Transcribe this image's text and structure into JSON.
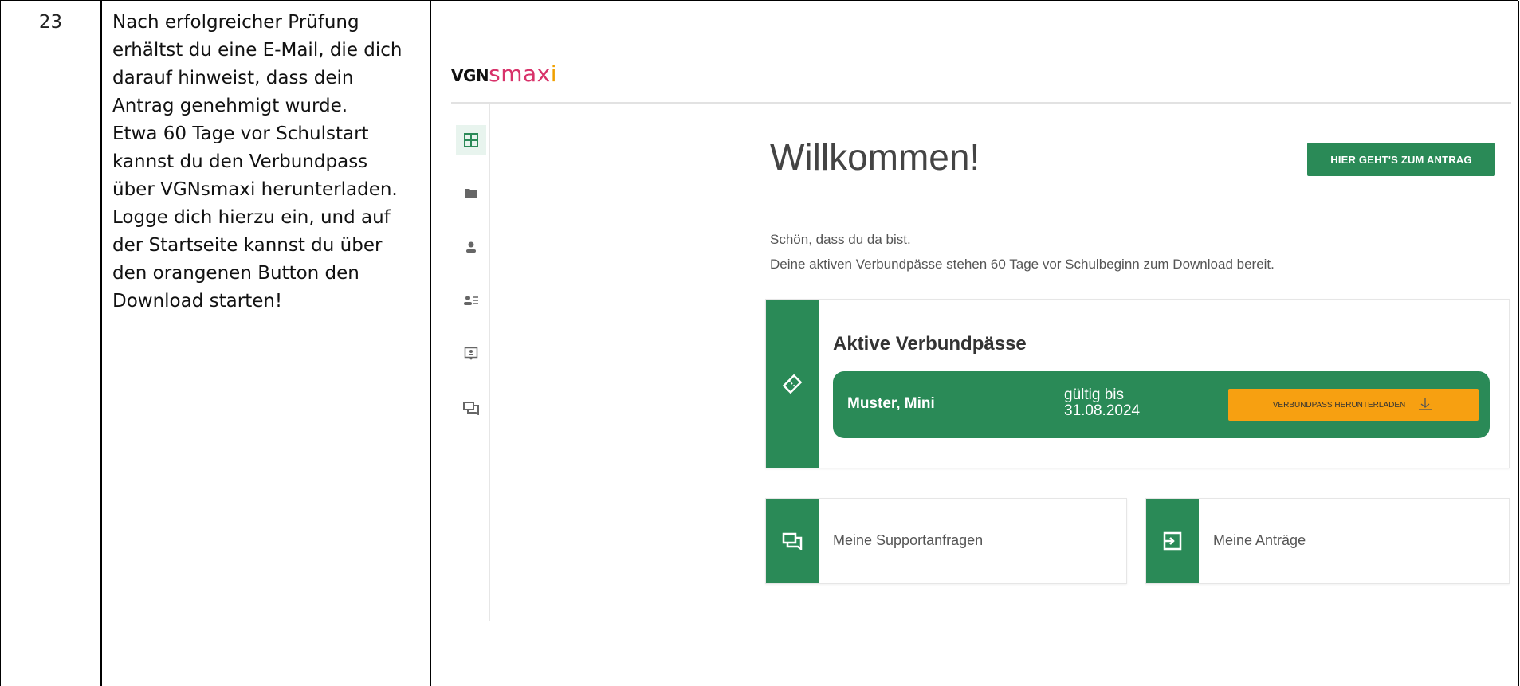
{
  "step": {
    "number": "23"
  },
  "instructions": {
    "lines": [
      "Nach erfolgreicher Prüfung",
      "erhältst du eine E-Mail, die dich",
      "darauf hinweist, dass dein",
      "Antrag genehmigt wurde.",
      "Etwa 60 Tage vor Schulstart",
      "kannst du den Verbundpass",
      "über VGNsmaxi herunterladen.",
      "Logge dich hierzu ein, und auf",
      "der Startseite kannst du über",
      "den orangenen Button den",
      "Download starten!"
    ]
  },
  "app": {
    "logo": {
      "vgn": "VGN",
      "smax": "smax",
      "i": "i"
    },
    "sidebar": {
      "icons": [
        "dashboard-icon",
        "folder-icon",
        "person-icon",
        "person-list-icon",
        "id-card-icon",
        "chat-icon"
      ]
    },
    "welcome": {
      "title": "Willkommen!",
      "antrag_button": "HIER GEHT'S ZUM ANTRAG"
    },
    "intro": {
      "line1": "Schön, dass du da bist.",
      "line2": "Deine aktiven Verbundpässe stehen 60 Tage vor Schulbeginn zum Download bereit."
    },
    "active_passes": {
      "title": "Aktive Verbundpässe",
      "pass": {
        "name": "Muster, Mini",
        "valid_label": "gültig bis",
        "valid_date": "31.08.2024",
        "download_button": "VERBUNDPASS HERUNTERLADEN"
      }
    },
    "cards": {
      "support": "Meine Supportanfragen",
      "antraege": "Meine Anträge"
    }
  },
  "colors": {
    "green": "#2a8a57",
    "orange": "#f7a011",
    "pink": "#d8326a"
  }
}
